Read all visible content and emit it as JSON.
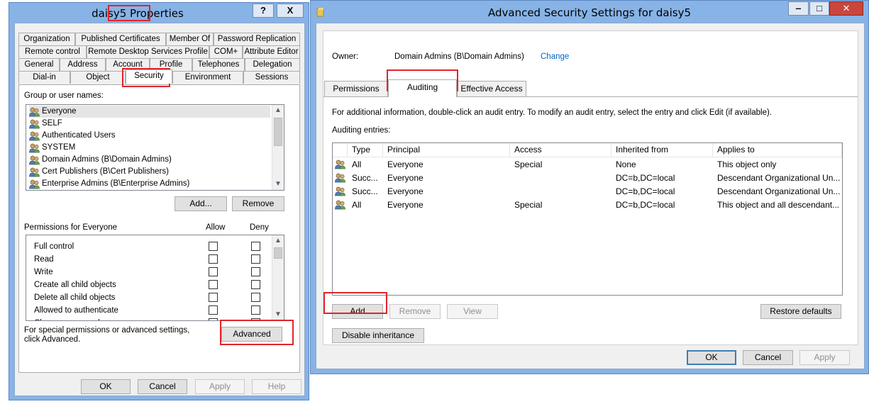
{
  "left_dialog": {
    "title_name": "daisy5",
    "title_suffix": "Properties",
    "help_btn": "?",
    "close_btn": "X",
    "tab_rows": [
      [
        "Organization",
        "Published Certificates",
        "Member Of",
        "Password Replication"
      ],
      [
        "Remote control",
        "Remote Desktop Services Profile",
        "COM+",
        "Attribute Editor"
      ],
      [
        "General",
        "Address",
        "Account",
        "Profile",
        "Telephones",
        "Delegation"
      ],
      [
        "Dial-in",
        "Object",
        "Security",
        "Environment",
        "Sessions"
      ]
    ],
    "group_label": "Group or user names:",
    "users": [
      "Everyone",
      "SELF",
      "Authenticated Users",
      "SYSTEM",
      "Domain Admins (B\\Domain Admins)",
      "Cert Publishers (B\\Cert Publishers)",
      "Enterprise Admins (B\\Enterprise Admins)"
    ],
    "add_btn": "Add...",
    "remove_btn": "Remove",
    "perm_label": "Permissions for Everyone",
    "allow_col": "Allow",
    "deny_col": "Deny",
    "permissions": [
      "Full control",
      "Read",
      "Write",
      "Create all child objects",
      "Delete all child objects",
      "Allowed to authenticate",
      "Change password"
    ],
    "special_text": "For special permissions or advanced settings, click Advanced.",
    "advanced_btn": "Advanced",
    "ok_btn": "OK",
    "cancel_btn": "Cancel",
    "apply_btn": "Apply",
    "help_bottom_btn": "Help"
  },
  "right_window": {
    "title": "Advanced Security Settings for daisy5",
    "owner_label": "Owner:",
    "owner_value": "Domain Admins (B\\Domain Admins)",
    "change_link": "Change",
    "tabs": [
      "Permissions",
      "Auditing",
      "Effective Access"
    ],
    "info_text": "For additional information, double-click an audit entry. To modify an audit entry, select the entry and click Edit (if available).",
    "entries_label": "Auditing entries:",
    "columns": [
      "Type",
      "Principal",
      "Access",
      "Inherited from",
      "Applies to"
    ],
    "rows": [
      [
        "All",
        "Everyone",
        "Special",
        "None",
        "This object only"
      ],
      [
        "Succ...",
        "Everyone",
        "",
        "DC=b,DC=local",
        "Descendant Organizational Un..."
      ],
      [
        "Succ...",
        "Everyone",
        "",
        "DC=b,DC=local",
        "Descendant Organizational Un..."
      ],
      [
        "All",
        "Everyone",
        "Special",
        "DC=b,DC=local",
        "This object and all descendant..."
      ]
    ],
    "add_btn": "Add",
    "remove_btn": "Remove",
    "view_btn": "View",
    "restore_btn": "Restore defaults",
    "disable_btn": "Disable inheritance",
    "ok_btn": "OK",
    "cancel_btn": "Cancel",
    "apply_btn": "Apply"
  },
  "colors": {
    "frame": "#87b3e6",
    "highlight": "#e0252b",
    "link": "#0066cc"
  }
}
